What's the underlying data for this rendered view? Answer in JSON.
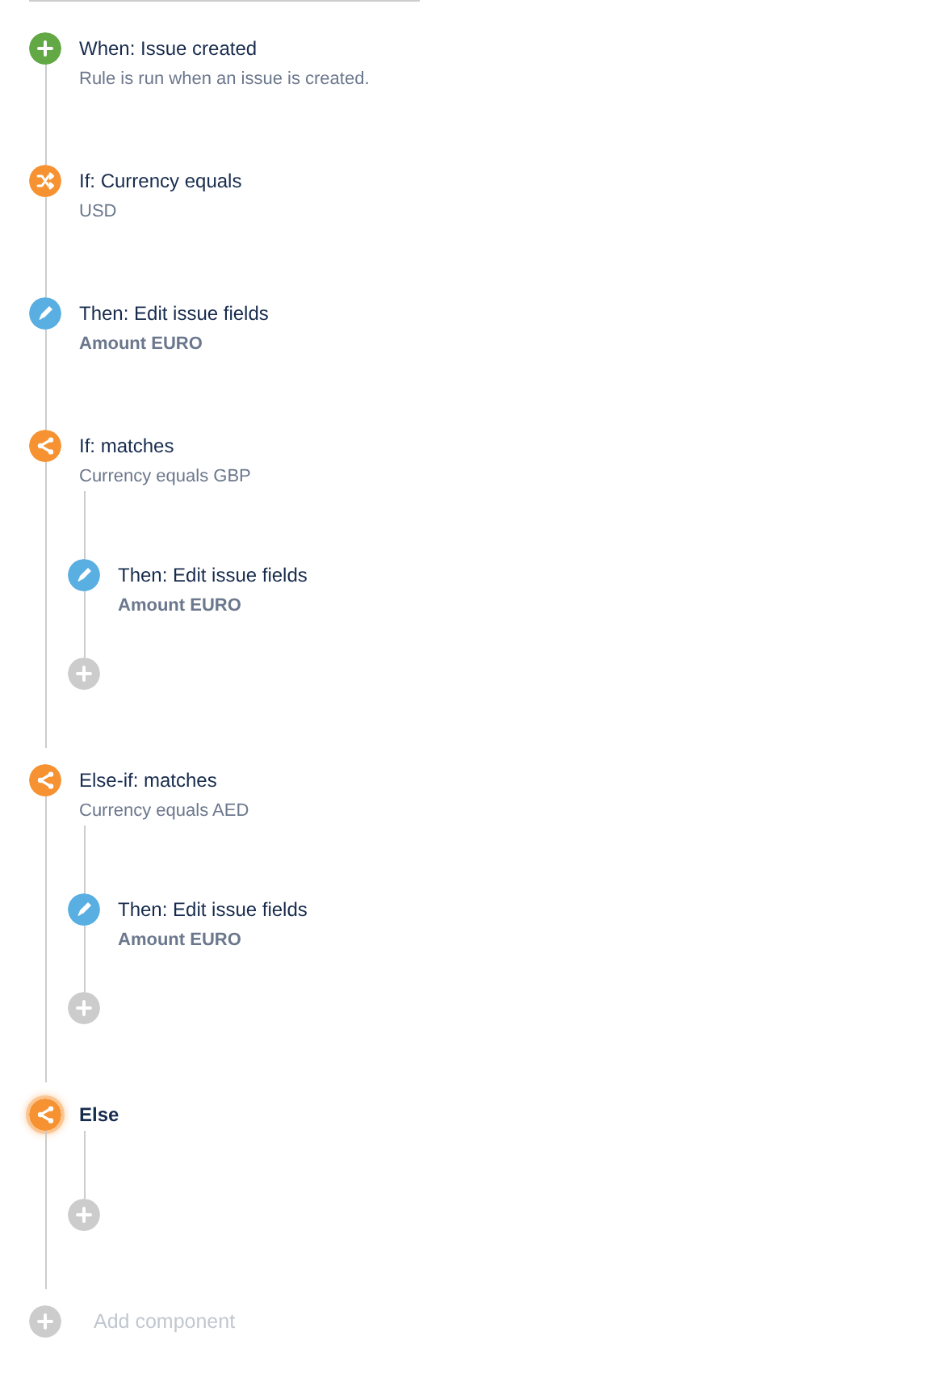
{
  "components": [
    {
      "kind": "trigger",
      "title": "When: Issue created",
      "subtitle": "Rule is run when an issue is created.",
      "subtitle_bold": false,
      "selected": false
    },
    {
      "kind": "condition",
      "title": "If: Currency equals",
      "subtitle": "USD",
      "subtitle_bold": false,
      "selected": false
    },
    {
      "kind": "action",
      "title": "Then: Edit issue fields",
      "subtitle": "Amount EURO",
      "subtitle_bold": true,
      "selected": false
    },
    {
      "kind": "branch",
      "title": "If: matches",
      "subtitle": "Currency equals GBP",
      "subtitle_bold": false,
      "selected": false,
      "children": [
        {
          "kind": "action",
          "title": "Then: Edit issue fields",
          "subtitle": "Amount EURO",
          "subtitle_bold": true,
          "selected": false
        },
        {
          "kind": "add"
        }
      ]
    },
    {
      "kind": "branch",
      "title": "Else-if: matches",
      "subtitle": "Currency equals AED",
      "subtitle_bold": false,
      "selected": false,
      "children": [
        {
          "kind": "action",
          "title": "Then: Edit issue fields",
          "subtitle": "Amount EURO",
          "subtitle_bold": true,
          "selected": false
        },
        {
          "kind": "add"
        }
      ]
    },
    {
      "kind": "branch",
      "title": "Else",
      "selected": true,
      "children": [
        {
          "kind": "add"
        }
      ]
    },
    {
      "kind": "add",
      "label": "Add component"
    }
  ]
}
